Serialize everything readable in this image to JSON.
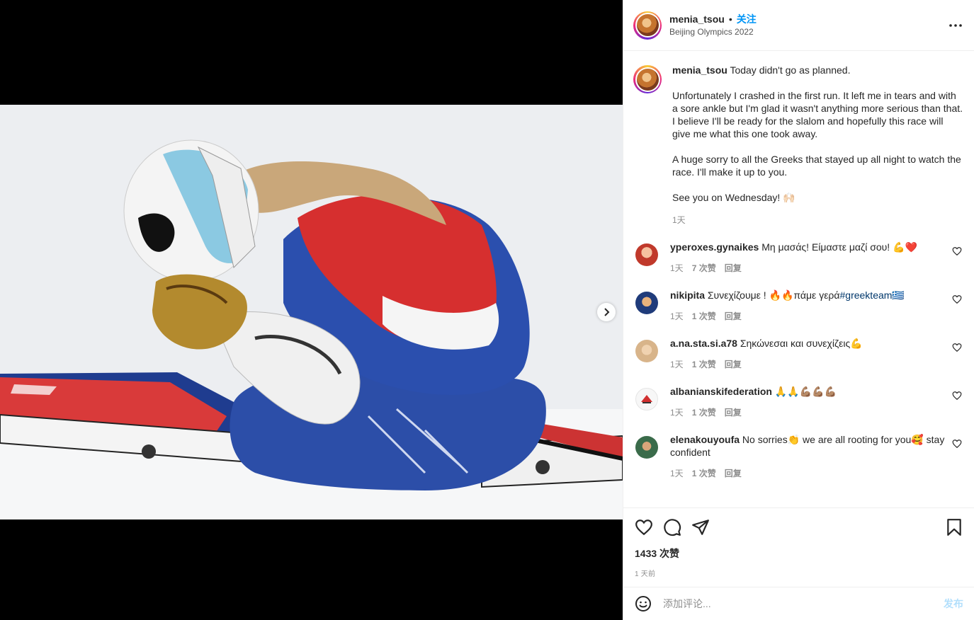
{
  "post": {
    "username": "menia_tsou",
    "follow_label": "关注",
    "separator": "•",
    "location": "Beijing Olympics 2022",
    "caption": {
      "username": "menia_tsou",
      "p1": "Today didn't go as planned.",
      "p2": "Unfortunately I crashed in the first run. It left me in tears and with a sore ankle but I'm glad it wasn't anything more serious than that. I believe I'll be ready for the slalom and hopefully this race will give me what this one took away.",
      "p3": "A huge sorry to all the Greeks that stayed up all night to watch the race. I'll make it up to you.",
      "p4": "See you on Wednesday! 🙌🏻",
      "age": "1天"
    },
    "image_alt": "Skier in blue suit and white helmet kneeling in snow, head in hands, after a crash"
  },
  "comments": [
    {
      "user": "yperoxes.gynaikes",
      "text": "Μη μασάς! Είμαστε μαζί σου! 💪❤️",
      "age": "1天",
      "likes": "7 次赞",
      "reply": "回复",
      "avatar_color": "#c0392b"
    },
    {
      "user": "nikipita",
      "text": "Συνεχίζουμε ! 🔥🔥πάμε γερά",
      "hashtag": "#greekteam🇬🇷",
      "age": "1天",
      "likes": "1 次赞",
      "reply": "回复",
      "avatar_color": "#1f3b7a"
    },
    {
      "user": "a.na.sta.si.a78",
      "text": "Σηκώνεσαι και συνεχίζεις💪",
      "age": "1天",
      "likes": "1 次赞",
      "reply": "回复",
      "avatar_color": "#d8b48a"
    },
    {
      "user": "albanianskifederation",
      "text": "🙏🙏💪🏽💪🏽💪🏽",
      "age": "1天",
      "likes": "1 次赞",
      "reply": "回复",
      "avatar_color": "#f2f2f2"
    },
    {
      "user": "elenakouyoufa",
      "text": "No sorries👏 we are all rooting for you🥰 stay confident",
      "age": "1天",
      "likes": "1 次赞",
      "reply": "回复",
      "avatar_color": "#3a6b4a"
    }
  ],
  "footer": {
    "likes": "1433 次赞",
    "time_ago": "1 天前",
    "comment_placeholder": "添加评论...",
    "post_label": "发布"
  },
  "icons": [
    "heart-icon",
    "comment-icon",
    "share-icon",
    "bookmark-icon",
    "more-icon",
    "emoji-icon",
    "chevron-right-icon"
  ],
  "colors": {
    "accent": "#0095f6",
    "post_disabled": "#b2dffc",
    "muted": "#8e8e8e"
  }
}
